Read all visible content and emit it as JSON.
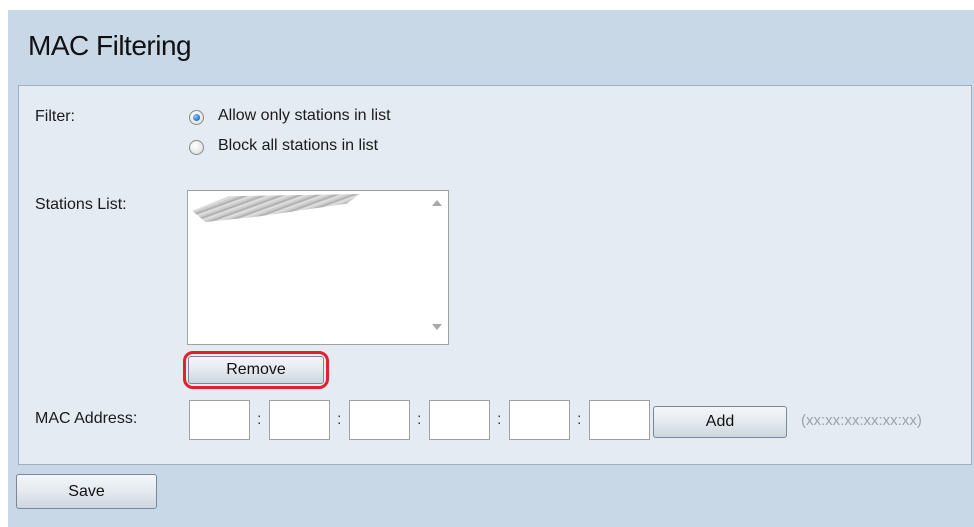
{
  "page": {
    "title": "MAC Filtering"
  },
  "filter": {
    "label": "Filter:",
    "options": [
      {
        "label": "Allow only stations in list",
        "selected": true
      },
      {
        "label": "Block all stations in list",
        "selected": false
      }
    ]
  },
  "stations": {
    "label": "Stations List:",
    "remove_label": "Remove"
  },
  "mac": {
    "label": "MAC Address:",
    "fields": [
      "",
      "",
      "",
      "",
      "",
      ""
    ],
    "separator": ":",
    "add_label": "Add",
    "format_hint": "(xx:xx:xx:xx:xx:xx)"
  },
  "footer": {
    "save_label": "Save"
  },
  "colors": {
    "highlight": "#e0202a",
    "background": "#c9d8e6",
    "panel": "#e4ebf2"
  }
}
